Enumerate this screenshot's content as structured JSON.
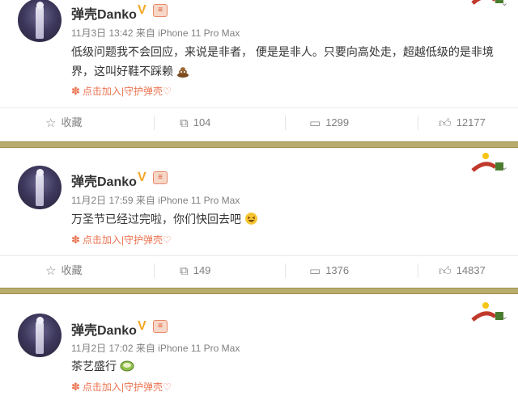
{
  "posts": [
    {
      "user": "弹壳Danko",
      "meta": "11月3日 13:42 来自 iPhone 11 Pro Max",
      "content": "低级问题我不会回应，来说是非者， 便是是非人。只要向高处走，超越低级的是非境界，这叫好鞋不踩赖",
      "emoji_icon": "poop-emoji",
      "source": "点击加入|守护弹壳♡",
      "actions": {
        "fav": "收藏",
        "repost": "104",
        "comment": "1299",
        "like": "12177"
      }
    },
    {
      "user": "弹壳Danko",
      "meta": "11月2日 17:59 来自 iPhone 11 Pro Max",
      "content": "万圣节已经过完啦，你们快回去吧",
      "emoji_icon": "laughing-emoji",
      "source": "点击加入|守护弹壳♡",
      "actions": {
        "fav": "收藏",
        "repost": "149",
        "comment": "1376",
        "like": "14837"
      }
    },
    {
      "user": "弹壳Danko",
      "meta": "11月2日 17:02 来自 iPhone 11 Pro Max",
      "content": "茶艺盛行",
      "emoji_icon": "tea-emoji",
      "source": "点击加入|守护弹壳♡"
    }
  ],
  "badges": {
    "v": "V",
    "level": "≡"
  },
  "colors": {
    "separator": "#b9ad6e",
    "source": "#eb7350",
    "meta": "#808080",
    "vip": "#f5a623"
  }
}
